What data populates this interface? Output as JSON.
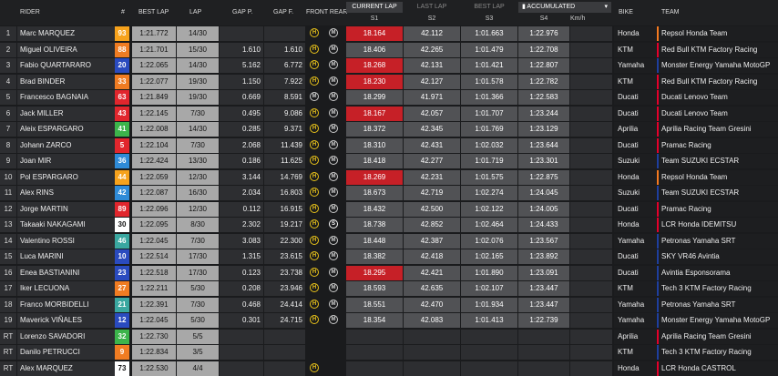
{
  "header": {
    "rider": "RIDER",
    "num": "#",
    "best": "BEST LAP",
    "lap": "LAP",
    "gap_p": "GAP P.",
    "gap_f": "GAP F.",
    "tyres": "FRONT REAR",
    "tabs": [
      "CURRENT LAP",
      "LAST LAP",
      "BEST LAP"
    ],
    "accumulated": "ACCUMULATED",
    "sectors": [
      "S1",
      "S2",
      "S3",
      "S4"
    ],
    "kmh": "Km/h",
    "bike": "BIKE",
    "team": "TEAM"
  },
  "colors": {
    "red": "#c62027",
    "accent_bar_red": "#e4002b",
    "accent_bar_blue": "#1e3f9e"
  },
  "rows": [
    {
      "pos": "1",
      "rider": "Marc MARQUEZ",
      "num": "93",
      "numColor": "#f6a21c",
      "best": "1:21.772",
      "lap": "14/30",
      "gp": "",
      "gf": "",
      "front": "H",
      "rear": "M",
      "s1": "18.164",
      "s1red": true,
      "s2": "42.112",
      "s3": "1:01.663",
      "s4": "1:22.976",
      "bike": "Honda",
      "team": "Repsol Honda Team",
      "teamColor": "#f47a20"
    },
    {
      "pos": "2",
      "rider": "Miguel OLIVEIRA",
      "num": "88",
      "numColor": "#f07c22",
      "best": "1:21.701",
      "lap": "15/30",
      "gp": "1.610",
      "gf": "1.610",
      "front": "H",
      "rear": "M",
      "s1": "18.406",
      "s1red": false,
      "s2": "42.265",
      "s3": "1:01.479",
      "s4": "1:22.708",
      "bike": "KTM",
      "team": "Red Bull KTM Factory Racing",
      "teamColor": "#e4002b"
    },
    {
      "pos": "3",
      "rider": "Fabio QUARTARARO",
      "num": "20",
      "numColor": "#2a4bbf",
      "best": "1:22.065",
      "lap": "14/30",
      "gp": "5.162",
      "gf": "6.772",
      "front": "H",
      "rear": "M",
      "s1": "18.268",
      "s1red": true,
      "s2": "42.131",
      "s3": "1:01.421",
      "s4": "1:22.807",
      "bike": "Yamaha",
      "team": "Monster Energy Yamaha MotoGP",
      "teamColor": "#1e3f9e"
    },
    {
      "pos": "4",
      "rider": "Brad BINDER",
      "num": "33",
      "numColor": "#f07c22",
      "best": "1:22.077",
      "lap": "19/30",
      "gp": "1.150",
      "gf": "7.922",
      "front": "H",
      "rear": "M",
      "s1": "18.230",
      "s1red": true,
      "s2": "42.127",
      "s3": "1:01.578",
      "s4": "1:22.782",
      "bike": "KTM",
      "team": "Red Bull KTM Factory Racing",
      "teamColor": "#e4002b"
    },
    {
      "pos": "5",
      "rider": "Francesco BAGNAIA",
      "num": "63",
      "numColor": "#e1262d",
      "best": "1:21.849",
      "lap": "19/30",
      "gp": "0.669",
      "gf": "8.591",
      "front": "M",
      "rear": "M",
      "s1": "18.299",
      "s1red": false,
      "s2": "41.971",
      "s3": "1:01.366",
      "s4": "1:22.583",
      "bike": "Ducati",
      "team": "Ducati Lenovo Team",
      "teamColor": "#e4002b"
    },
    {
      "pos": "6",
      "rider": "Jack MILLER",
      "num": "43",
      "numColor": "#e1262d",
      "best": "1:22.145",
      "lap": "7/30",
      "gp": "0.495",
      "gf": "9.086",
      "front": "H",
      "rear": "M",
      "s1": "18.167",
      "s1red": true,
      "s2": "42.057",
      "s3": "1:01.707",
      "s4": "1:23.244",
      "bike": "Ducati",
      "team": "Ducati Lenovo Team",
      "teamColor": "#e4002b"
    },
    {
      "pos": "7",
      "rider": "Aleix ESPARGARO",
      "num": "41",
      "numColor": "#3cb44b",
      "best": "1:22.008",
      "lap": "14/30",
      "gp": "0.285",
      "gf": "9.371",
      "front": "H",
      "rear": "M",
      "s1": "18.372",
      "s1red": false,
      "s2": "42.345",
      "s3": "1:01.769",
      "s4": "1:23.129",
      "bike": "Aprilia",
      "team": "Aprilia Racing Team Gresini",
      "teamColor": "#e4002b"
    },
    {
      "pos": "8",
      "rider": "Johann ZARCO",
      "num": "5",
      "numColor": "#e1262d",
      "best": "1:22.104",
      "lap": "7/30",
      "gp": "2.068",
      "gf": "11.439",
      "front": "H",
      "rear": "M",
      "s1": "18.310",
      "s1red": false,
      "s2": "42.431",
      "s3": "1:02.032",
      "s4": "1:23.644",
      "bike": "Ducati",
      "team": "Pramac Racing",
      "teamColor": "#e4002b"
    },
    {
      "pos": "9",
      "rider": "Joan MIR",
      "num": "36",
      "numColor": "#2f8bd8",
      "best": "1:22.424",
      "lap": "13/30",
      "gp": "0.186",
      "gf": "11.625",
      "front": "H",
      "rear": "M",
      "s1": "18.418",
      "s1red": false,
      "s2": "42.277",
      "s3": "1:01.719",
      "s4": "1:23.301",
      "bike": "Suzuki",
      "team": "Team SUZUKI ECSTAR",
      "teamColor": "#1e3f9e"
    },
    {
      "pos": "10",
      "rider": "Pol ESPARGARO",
      "num": "44",
      "numColor": "#f6a21c",
      "best": "1:22.059",
      "lap": "12/30",
      "gp": "3.144",
      "gf": "14.769",
      "front": "H",
      "rear": "M",
      "s1": "18.269",
      "s1red": true,
      "s2": "42.231",
      "s3": "1:01.575",
      "s4": "1:22.875",
      "bike": "Honda",
      "team": "Repsol Honda Team",
      "teamColor": "#f47a20"
    },
    {
      "pos": "11",
      "rider": "Alex RINS",
      "num": "42",
      "numColor": "#2f8bd8",
      "best": "1:22.087",
      "lap": "16/30",
      "gp": "2.034",
      "gf": "16.803",
      "front": "H",
      "rear": "M",
      "s1": "18.673",
      "s1red": false,
      "s2": "42.719",
      "s3": "1:02.274",
      "s4": "1:24.045",
      "bike": "Suzuki",
      "team": "Team SUZUKI ECSTAR",
      "teamColor": "#1e3f9e"
    },
    {
      "pos": "12",
      "rider": "Jorge MARTIN",
      "num": "89",
      "numColor": "#e1262d",
      "best": "1:22.096",
      "lap": "12/30",
      "gp": "0.112",
      "gf": "16.915",
      "front": "H",
      "rear": "M",
      "s1": "18.432",
      "s1red": false,
      "s2": "42.500",
      "s3": "1:02.122",
      "s4": "1:24.005",
      "bike": "Ducati",
      "team": "Pramac Racing",
      "teamColor": "#e4002b"
    },
    {
      "pos": "13",
      "rider": "Takaaki NAKAGAMI",
      "num": "30",
      "numColor": "#ffffff",
      "best": "1:22.095",
      "lap": "8/30",
      "gp": "2.302",
      "gf": "19.217",
      "front": "H",
      "rear": "S",
      "s1": "18.738",
      "s1red": false,
      "s2": "42.852",
      "s3": "1:02.464",
      "s4": "1:24.433",
      "bike": "Honda",
      "team": "LCR Honda IDEMITSU",
      "teamColor": "#e4002b"
    },
    {
      "pos": "14",
      "rider": "Valentino ROSSI",
      "num": "46",
      "numColor": "#3aa7a0",
      "best": "1:22.045",
      "lap": "7/30",
      "gp": "3.083",
      "gf": "22.300",
      "front": "H",
      "rear": "M",
      "s1": "18.448",
      "s1red": false,
      "s2": "42.387",
      "s3": "1:02.076",
      "s4": "1:23.567",
      "bike": "Yamaha",
      "team": "Petronas Yamaha SRT",
      "teamColor": "#1e3f9e"
    },
    {
      "pos": "15",
      "rider": "Luca MARINI",
      "num": "10",
      "numColor": "#2a4bbf",
      "best": "1:22.514",
      "lap": "17/30",
      "gp": "1.315",
      "gf": "23.615",
      "front": "H",
      "rear": "M",
      "s1": "18.382",
      "s1red": false,
      "s2": "42.418",
      "s3": "1:02.165",
      "s4": "1:23.892",
      "bike": "Ducati",
      "team": "SKY VR46 Avintia",
      "teamColor": "#1e3f9e"
    },
    {
      "pos": "16",
      "rider": "Enea BASTIANINI",
      "num": "23",
      "numColor": "#2a4bbf",
      "best": "1:22.518",
      "lap": "17/30",
      "gp": "0.123",
      "gf": "23.738",
      "front": "H",
      "rear": "M",
      "s1": "18.295",
      "s1red": true,
      "s2": "42.421",
      "s3": "1:01.890",
      "s4": "1:23.091",
      "bike": "Ducati",
      "team": "Avintia Esponsorama",
      "teamColor": "#1e3f9e"
    },
    {
      "pos": "17",
      "rider": "Iker LECUONA",
      "num": "27",
      "numColor": "#f07c22",
      "best": "1:22.211",
      "lap": "5/30",
      "gp": "0.208",
      "gf": "23.946",
      "front": "H",
      "rear": "M",
      "s1": "18.593",
      "s1red": false,
      "s2": "42.635",
      "s3": "1:02.107",
      "s4": "1:23.447",
      "bike": "KTM",
      "team": "Tech 3 KTM Factory Racing",
      "teamColor": "#1e3f9e"
    },
    {
      "pos": "18",
      "rider": "Franco MORBIDELLI",
      "num": "21",
      "numColor": "#3aa7a0",
      "best": "1:22.391",
      "lap": "7/30",
      "gp": "0.468",
      "gf": "24.414",
      "front": "H",
      "rear": "M",
      "s1": "18.551",
      "s1red": false,
      "s2": "42.470",
      "s3": "1:01.934",
      "s4": "1:23.447",
      "bike": "Yamaha",
      "team": "Petronas Yamaha SRT",
      "teamColor": "#1e3f9e"
    },
    {
      "pos": "19",
      "rider": "Maverick VIÑALES",
      "num": "12",
      "numColor": "#2a4bbf",
      "best": "1:22.045",
      "lap": "5/30",
      "gp": "0.301",
      "gf": "24.715",
      "front": "H",
      "rear": "M",
      "s1": "18.354",
      "s1red": false,
      "s2": "42.083",
      "s3": "1:01.413",
      "s4": "1:22.739",
      "bike": "Yamaha",
      "team": "Monster Energy Yamaha MotoGP",
      "teamColor": "#1e3f9e"
    },
    {
      "pos": "RT",
      "rider": "Lorenzo SAVADORI",
      "num": "32",
      "numColor": "#3cb44b",
      "best": "1:22.730",
      "lap": "5/5",
      "gp": "",
      "gf": "",
      "front": "",
      "rear": "",
      "s1": "",
      "s1red": false,
      "s2": "",
      "s3": "",
      "s4": "",
      "bike": "Aprilia",
      "team": "Aprilia Racing Team Gresini",
      "teamColor": "#e4002b"
    },
    {
      "pos": "RT",
      "rider": "Danilo PETRUCCI",
      "num": "9",
      "numColor": "#f07c22",
      "best": "1:22.834",
      "lap": "3/5",
      "gp": "",
      "gf": "",
      "front": "",
      "rear": "",
      "s1": "",
      "s1red": false,
      "s2": "",
      "s3": "",
      "s4": "",
      "bike": "KTM",
      "team": "Tech 3 KTM Factory Racing",
      "teamColor": "#1e3f9e"
    },
    {
      "pos": "RT",
      "rider": "Alex MARQUEZ",
      "num": "73",
      "numColor": "#ffffff",
      "best": "1:22.530",
      "lap": "4/4",
      "gp": "",
      "gf": "",
      "front": "H",
      "rear": "",
      "s1": "",
      "s1red": false,
      "s2": "",
      "s3": "",
      "s4": "",
      "bike": "Honda",
      "team": "LCR Honda CASTROL",
      "teamColor": "#e4002b"
    }
  ]
}
